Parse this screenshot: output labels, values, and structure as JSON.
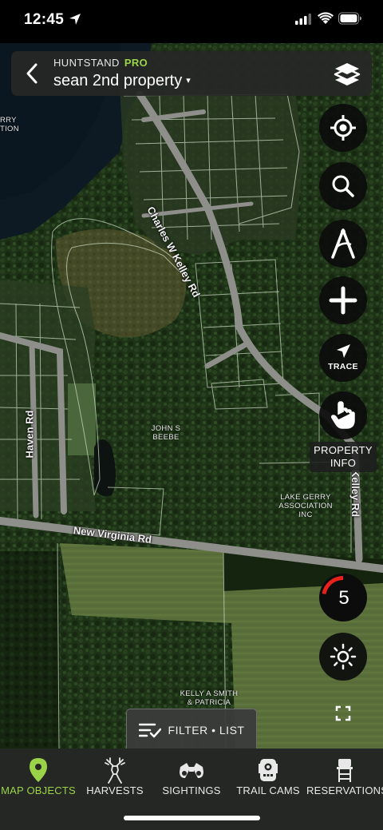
{
  "status_bar": {
    "time": "12:45"
  },
  "header": {
    "brand": "HUNTSTAND",
    "brand_tier": "PRO",
    "property_name": "sean 2nd property",
    "caret": "▾"
  },
  "map": {
    "road_labels": [
      "Charles W Kelley Rd",
      "Haven Rd",
      "New Virginia Rd",
      "Kelley Rd"
    ],
    "parcel_labels": [
      "RRY\nTION",
      "JOHN S\nBEEBE",
      "LAKE GERRY\nASSOCIATION\nINC",
      "KELLY A SMITH\n& PATRICIA"
    ]
  },
  "controls": {
    "trace_label": "TRACE",
    "property_info_label": "PROPERTY\nINFO",
    "count": "5",
    "accent_color": "#e8221b"
  },
  "filter": {
    "label": "FILTER • LIST"
  },
  "tabs": [
    {
      "label": "MAP OBJECTS",
      "icon": "map-pin-icon",
      "active": true
    },
    {
      "label": "HARVESTS",
      "icon": "deer-icon",
      "active": false
    },
    {
      "label": "SIGHTINGS",
      "icon": "binoculars-icon",
      "active": false
    },
    {
      "label": "TRAIL CAMS",
      "icon": "trail-camera-icon",
      "active": false
    },
    {
      "label": "RESERVATIONS",
      "icon": "tree-stand-icon",
      "active": false
    }
  ],
  "colors": {
    "brand_green": "#9bd348",
    "tabbar_bg": "#252725"
  }
}
